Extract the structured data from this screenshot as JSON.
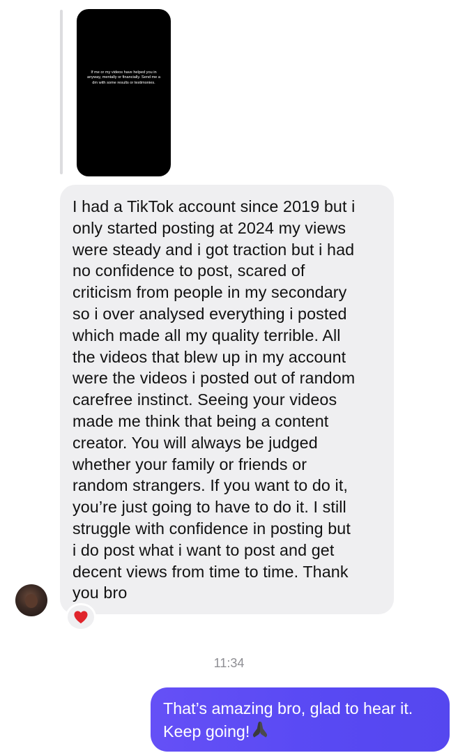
{
  "story_reply": {
    "story_text": "If me or my videos have helped you in anyway, mentally or financially. Send me a dm with some results or testimonies."
  },
  "incoming_message": {
    "text": "I had a TikTok account since 2019 but i\nonly started posting at 2024 my views\nwere steady and i got traction but i had\nno confidence to post, scared of\ncriticism from people in my secondary\nso i over analysed everything i posted\nwhich made all my quality terrible. All\nthe videos that blew up in my account\nwere the videos i posted out of random\ncarefree instinct. Seeing your videos\nmade me think that being a content\ncreator. You will always be judged\nwhether your family or friends or\nrandom strangers. If you want to do it,\nyou’re just going to have to do it. I still\nstruggle with confidence in posting but\ni do post what i want to post and get\ndecent views from time to time. Thank\nyou bro",
    "reaction": "red-heart-icon"
  },
  "timestamp": "11:34",
  "outgoing_message": {
    "text": "That’s amazing bro, glad to hear it.\nKeep going!"
  },
  "icons": {
    "pray": "folded-hands-icon"
  },
  "colors": {
    "incoming_bubble": "#efeff1",
    "outgoing_bubble": "#5a4af4",
    "timestamp": "#8e8e93",
    "heart": "#e0242b"
  }
}
